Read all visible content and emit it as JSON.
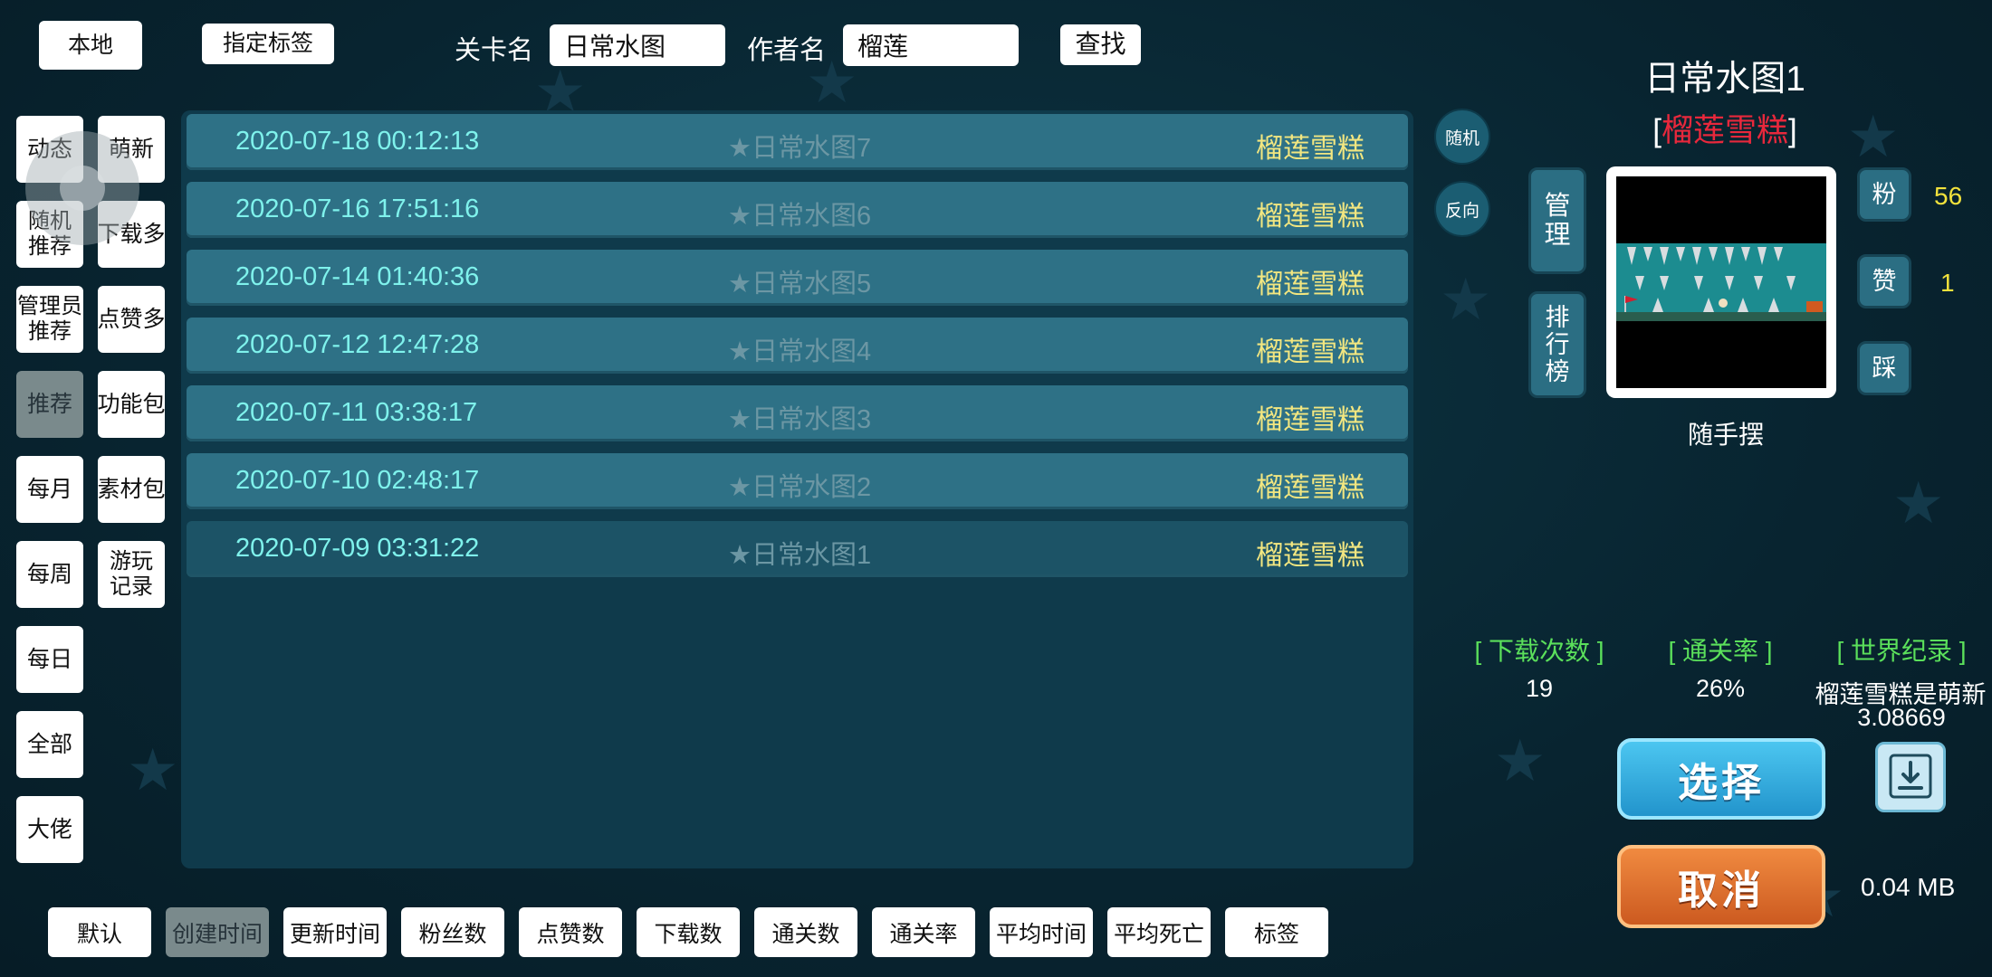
{
  "top": {
    "local_label": "本地",
    "tag_label": "指定标签",
    "level_name_label": "关卡名",
    "level_name_value": "日常水图",
    "author_label": "作者名",
    "author_value": "榴莲",
    "search_label": "查找"
  },
  "categories": [
    {
      "label": "动态"
    },
    {
      "label": "萌新"
    },
    {
      "label": "随机\n推荐"
    },
    {
      "label": "下载多"
    },
    {
      "label": "管理员\n推荐"
    },
    {
      "label": "点赞多"
    },
    {
      "label": "推荐",
      "selected": true
    },
    {
      "label": "功能包"
    },
    {
      "label": "每月"
    },
    {
      "label": "素材包"
    },
    {
      "label": "每周"
    },
    {
      "label": "游玩\n记录"
    },
    {
      "label": "每日"
    },
    {
      "label": "全部"
    },
    {
      "label": "大佬"
    }
  ],
  "levels": [
    {
      "date": "2020-07-18 00:12:13",
      "title": "★日常水图7",
      "author": "榴莲雪糕"
    },
    {
      "date": "2020-07-16 17:51:16",
      "title": "★日常水图6",
      "author": "榴莲雪糕"
    },
    {
      "date": "2020-07-14 01:40:36",
      "title": "★日常水图5",
      "author": "榴莲雪糕"
    },
    {
      "date": "2020-07-12 12:47:28",
      "title": "★日常水图4",
      "author": "榴莲雪糕"
    },
    {
      "date": "2020-07-11 03:38:17",
      "title": "★日常水图3",
      "author": "榴莲雪糕"
    },
    {
      "date": "2020-07-10 02:48:17",
      "title": "★日常水图2",
      "author": "榴莲雪糕"
    },
    {
      "date": "2020-07-09 03:31:22",
      "title": "★日常水图1",
      "author": "榴莲雪糕"
    }
  ],
  "list_controls": {
    "random": "随机",
    "reverse": "反向"
  },
  "detail": {
    "title": "日常水图1",
    "author_bracket_open": "[",
    "author": "榴莲雪糕",
    "author_bracket_close": "]",
    "manage": "管\n理",
    "rank": "排\n行\n榜",
    "fans_label": "粉",
    "fans_value": "56",
    "likes_label": "赞",
    "likes_value": "1",
    "dislike_label": "踩",
    "caption": "随手摆",
    "downloads_label": "[ 下载次数 ]",
    "downloads_value": "19",
    "clear_rate_label": "[ 通关率 ]",
    "clear_rate_value": "26%",
    "record_label": "[ 世界纪录 ]",
    "record_holder": "榴莲雪糕是萌新",
    "record_time": "3.08669",
    "select": "选择",
    "cancel": "取消",
    "size": "0.04 MB"
  },
  "sort_tabs": [
    {
      "label": "默认"
    },
    {
      "label": "创建时间",
      "selected": true
    },
    {
      "label": "更新时间"
    },
    {
      "label": "粉丝数"
    },
    {
      "label": "点赞数"
    },
    {
      "label": "下载数"
    },
    {
      "label": "通关数"
    },
    {
      "label": "通关率"
    },
    {
      "label": "平均时间"
    },
    {
      "label": "平均死亡"
    },
    {
      "label": "标签"
    }
  ],
  "colors": {
    "row": "#2e7186",
    "date_text": "#7ff2ec",
    "author_text": "#f2e680",
    "detail_author": "#e8283c",
    "stat_heading": "#5be05b",
    "count_text": "#f2e23c"
  }
}
